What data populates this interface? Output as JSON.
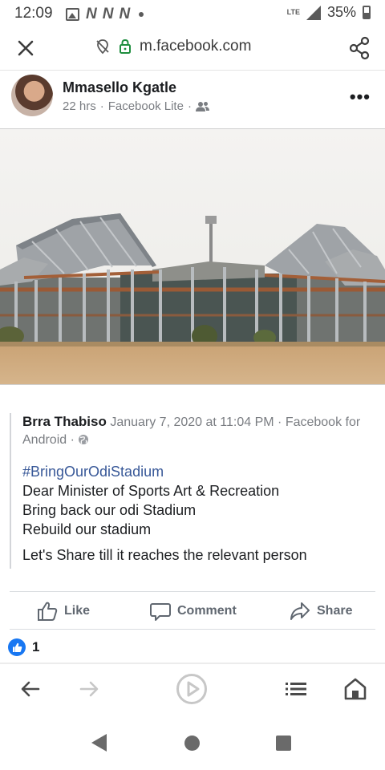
{
  "status_bar": {
    "time": "12:09",
    "network": "LTE",
    "battery": "35%",
    "icons": [
      "image-icon",
      "n-notification-icon",
      "n-notification-icon",
      "n-notification-icon",
      "dot-icon",
      "signal-icon",
      "battery-icon"
    ]
  },
  "url_bar": {
    "url": "m.facebook.com",
    "icons": [
      "close-icon",
      "location-off-icon",
      "lock-icon",
      "share-icon"
    ]
  },
  "post": {
    "author": "Mmasello Kgatle",
    "time": "22 hrs",
    "source": "Facebook Lite",
    "separator": "·",
    "audience_icon": "friends-icon",
    "more": "•••",
    "image_description_icon": "stadium-photo"
  },
  "shared_post": {
    "author": "Brra Thabiso",
    "timestamp": "January 7, 2020 at 11:04 PM",
    "source": "Facebook for Android",
    "separator": " · ",
    "audience_icon": "globe-icon",
    "hashtag": "#BringOurOdiStadium",
    "lines": [
      "Dear Minister of Sports Art & Recreation",
      "Bring back our odi Stadium",
      "Rebuild our stadium"
    ],
    "closing": "Let's Share till it reaches the relevant person"
  },
  "actions": {
    "like": "Like",
    "comment": "Comment",
    "share": "Share"
  },
  "reactions": {
    "count": "1",
    "icon": "like-reaction-icon"
  },
  "browser_nav": {
    "icons": [
      "back-arrow-icon",
      "forward-arrow-icon",
      "play-icon",
      "list-icon",
      "home-icon"
    ]
  },
  "system_nav": {
    "icons": [
      "system-back-icon",
      "system-home-icon",
      "system-recents-icon"
    ]
  },
  "colors": {
    "link_blue": "#385898",
    "like_blue": "#1877f2",
    "lock_green": "#1e8e3e",
    "meta_gray": "#7a7d82"
  }
}
